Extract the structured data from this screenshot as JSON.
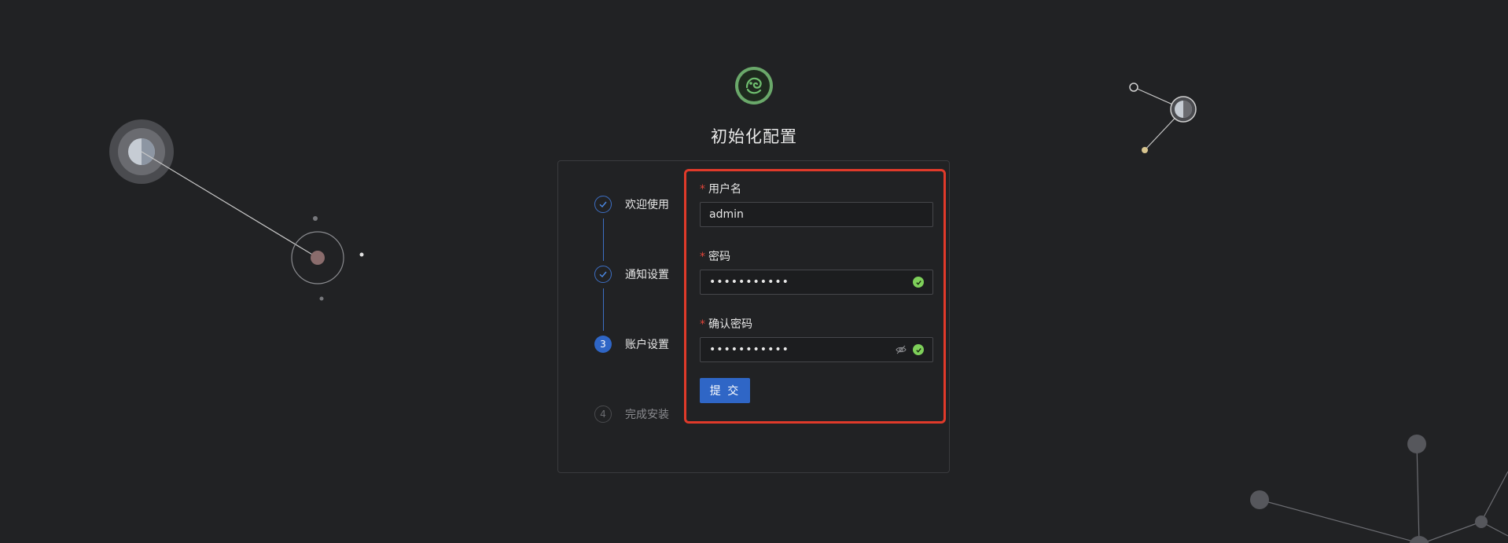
{
  "page": {
    "title": "初始化配置"
  },
  "steps": [
    {
      "index": "1",
      "label": "欢迎使用",
      "status": "done"
    },
    {
      "index": "2",
      "label": "通知设置",
      "status": "done"
    },
    {
      "index": "3",
      "label": "账户设置",
      "status": "active"
    },
    {
      "index": "4",
      "label": "完成安装",
      "status": "wait"
    }
  ],
  "form": {
    "username": {
      "label": "用户名",
      "value": "admin"
    },
    "password": {
      "label": "密码",
      "value": "•••••••••••",
      "status_icon": "check-circle-icon"
    },
    "confirm_password": {
      "label": "确认密码",
      "value": "•••••••••••",
      "status_icon": "check-circle-icon",
      "toggle_icon": "eye-off-icon"
    },
    "required_mark": "*",
    "submit_label": "提 交"
  },
  "colors": {
    "accent": "#2f66c6",
    "highlight_border": "#e03a2a",
    "success": "#7ed05a",
    "required": "#e2453a"
  }
}
